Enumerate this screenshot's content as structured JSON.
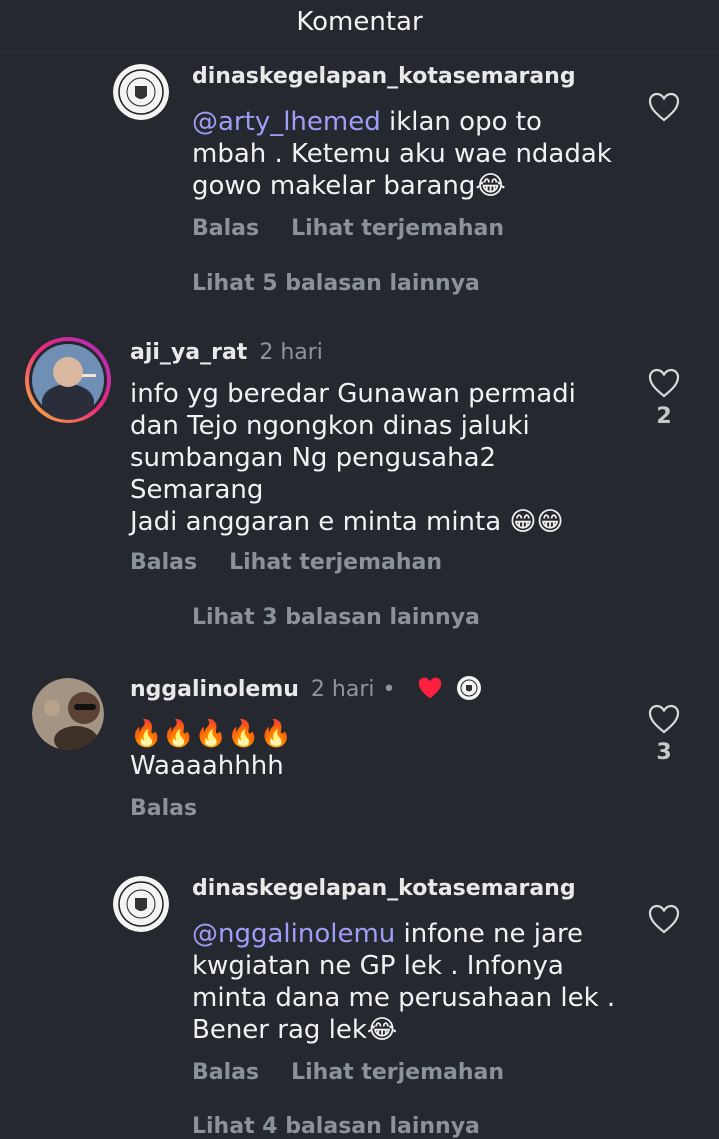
{
  "header": {
    "title": "Komentar"
  },
  "comments": [
    {
      "username": "dinaskegelapan_kotasemarang",
      "time": "",
      "mention": "@arty_lhemed",
      "text_lines": [
        " iklan opo to",
        "mbah . Ketemu aku wae ndadak",
        "gowo makelar barang😂"
      ],
      "reply_label": "Balas",
      "translate_label": "Lihat terjemahan",
      "like_count": "",
      "more_replies": "Lihat 5 balasan lainnya"
    },
    {
      "username": "aji_ya_rat",
      "time": "2 hari",
      "mention": "",
      "text_lines": [
        "info yg beredar Gunawan permadi",
        "dan Tejo ngongkon dinas jaluki",
        "sumbangan Ng pengusaha2",
        "Semarang",
        "Jadi anggaran e minta minta 😁😁"
      ],
      "reply_label": "Balas",
      "translate_label": "Lihat terjemahan",
      "like_count": "2",
      "more_replies": "Lihat 3 balasan lainnya"
    },
    {
      "username": "nggalinolemu",
      "time": "2 hari",
      "dot": "•",
      "mention": "",
      "text_lines": [
        "🔥🔥🔥🔥🔥",
        "Waaaahhhh"
      ],
      "reply_label": "Balas",
      "like_count": "3"
    },
    {
      "username": "dinaskegelapan_kotasemarang",
      "time": "",
      "mention": "@nggalinolemu",
      "text_lines": [
        " infone ne jare",
        "kwgiatan ne GP lek . Infonya",
        "minta dana me perusahaan lek .",
        "Bener rag lek😂"
      ],
      "reply_label": "Balas",
      "translate_label": "Lihat terjemahan",
      "like_count": "",
      "more_replies": "Lihat 4 balasan lainnya"
    }
  ]
}
